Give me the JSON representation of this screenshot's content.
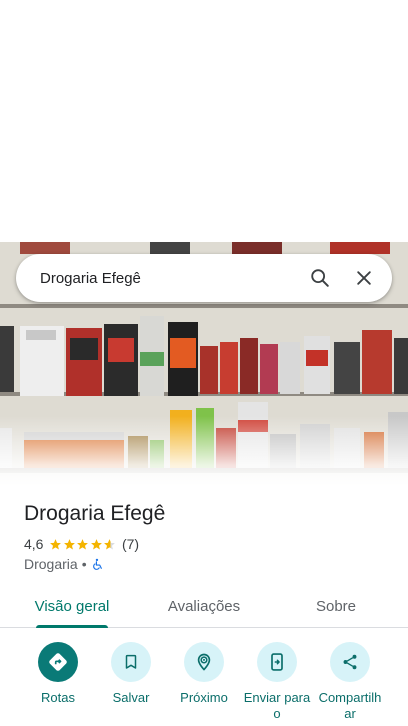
{
  "search": {
    "query": "Drogaria Efegê"
  },
  "place": {
    "name": "Drogaria Efegê",
    "rating": "4,6",
    "review_count": "(7)",
    "rating_stars": 4.6,
    "category": "Drogaria",
    "separator": "•"
  },
  "tabs": [
    {
      "label": "Visão geral"
    },
    {
      "label": "Avaliações"
    },
    {
      "label": "Sobre"
    }
  ],
  "actions": [
    {
      "label": "Rotas",
      "icon": "directions-icon"
    },
    {
      "label": "Salvar",
      "icon": "bookmark-icon"
    },
    {
      "label": "Próximo",
      "icon": "nearby-icon"
    },
    {
      "label": "Enviar para o",
      "icon": "send-to-phone-icon"
    },
    {
      "label": "Compartilhar",
      "icon": "share-icon"
    }
  ],
  "colors": {
    "accent": "#00796b",
    "action_bg": "#d7f3f8",
    "primary_action_bg": "#0a7a77",
    "star": "#f4b400"
  }
}
